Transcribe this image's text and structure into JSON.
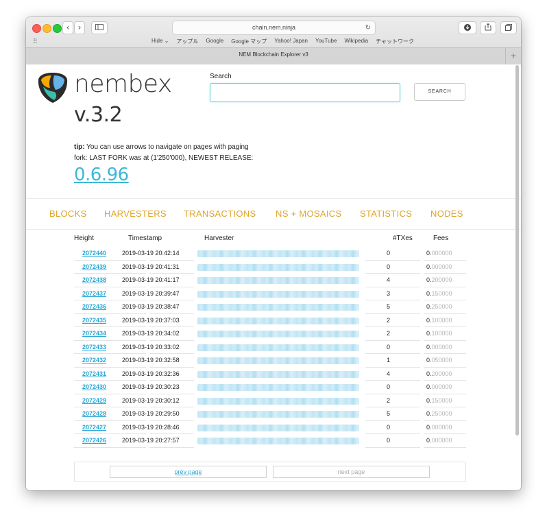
{
  "browser": {
    "url": "chain.nem.ninja",
    "tab_title": "NEM Blockchain Explorer v3",
    "bookmarks": [
      "Hide ⌄",
      "アップル",
      "Google",
      "Google マップ",
      "Yahoo! Japan",
      "YouTube",
      "Wikipedia",
      "チャットワーク"
    ],
    "icons": [
      "back-icon",
      "forward-icon",
      "sidebar-icon",
      "reload-icon",
      "download-icon",
      "share-icon",
      "tabs-icon",
      "grid-icon",
      "plus-icon"
    ]
  },
  "header": {
    "brand": "nembex",
    "version": "v.3.2",
    "search_label": "Search",
    "search_button": "SEARCH",
    "search_value": ""
  },
  "notes": {
    "tip_label": "tip:",
    "tip_text": " You can use arrows to navigate on pages with paging",
    "fork_text": "fork: LAST FORK was at (1'250'000), NEWEST RELEASE:",
    "release": "0.6.96"
  },
  "nav": [
    "BLOCKS",
    "HARVESTERS",
    "TRANSACTIONS",
    "NS + MOSAICS",
    "STATISTICS",
    "NODES"
  ],
  "table": {
    "headers": [
      "Height",
      "Timestamp",
      "Harvester",
      "#TXes",
      "Fees"
    ],
    "rows": [
      {
        "height": "2072440",
        "timestamp": "2019-03-19 20:42:14",
        "txes": "0",
        "fee_int": "0.",
        "fee_dec": "000000"
      },
      {
        "height": "2072439",
        "timestamp": "2019-03-19 20:41:31",
        "txes": "0",
        "fee_int": "0.",
        "fee_dec": "000000"
      },
      {
        "height": "2072438",
        "timestamp": "2019-03-19 20:41:17",
        "txes": "4",
        "fee_int": "0.",
        "fee_dec": "200000"
      },
      {
        "height": "2072437",
        "timestamp": "2019-03-19 20:39:47",
        "txes": "3",
        "fee_int": "0.",
        "fee_dec": "150000"
      },
      {
        "height": "2072436",
        "timestamp": "2019-03-19 20:38:47",
        "txes": "5",
        "fee_int": "0.",
        "fee_dec": "250000"
      },
      {
        "height": "2072435",
        "timestamp": "2019-03-19 20:37:03",
        "txes": "2",
        "fee_int": "0.",
        "fee_dec": "100000"
      },
      {
        "height": "2072434",
        "timestamp": "2019-03-19 20:34:02",
        "txes": "2",
        "fee_int": "0.",
        "fee_dec": "100000"
      },
      {
        "height": "2072433",
        "timestamp": "2019-03-19 20:33:02",
        "txes": "0",
        "fee_int": "0.",
        "fee_dec": "000000"
      },
      {
        "height": "2072432",
        "timestamp": "2019-03-19 20:32:58",
        "txes": "1",
        "fee_int": "0.",
        "fee_dec": "050000"
      },
      {
        "height": "2072431",
        "timestamp": "2019-03-19 20:32:36",
        "txes": "4",
        "fee_int": "0.",
        "fee_dec": "200000"
      },
      {
        "height": "2072430",
        "timestamp": "2019-03-19 20:30:23",
        "txes": "0",
        "fee_int": "0.",
        "fee_dec": "000000"
      },
      {
        "height": "2072429",
        "timestamp": "2019-03-19 20:30:12",
        "txes": "2",
        "fee_int": "0.",
        "fee_dec": "150000"
      },
      {
        "height": "2072428",
        "timestamp": "2019-03-19 20:29:50",
        "txes": "5",
        "fee_int": "0.",
        "fee_dec": "250000"
      },
      {
        "height": "2072427",
        "timestamp": "2019-03-19 20:28:46",
        "txes": "0",
        "fee_int": "0.",
        "fee_dec": "000000"
      },
      {
        "height": "2072426",
        "timestamp": "2019-03-19 20:27:57",
        "txes": "0",
        "fee_int": "0.",
        "fee_dec": "000000"
      }
    ]
  },
  "pager": {
    "prev": "prev page",
    "next": "next page"
  },
  "colors": {
    "accent": "#dea529",
    "link": "#2aa7d6",
    "search_border": "#5ad1d4"
  }
}
